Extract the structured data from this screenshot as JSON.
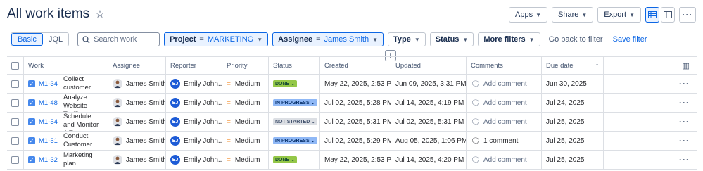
{
  "header": {
    "title": "All work items",
    "apps_label": "Apps",
    "share_label": "Share",
    "export_label": "Export"
  },
  "filters": {
    "basic_label": "Basic",
    "jql_label": "JQL",
    "search_placeholder": "Search work",
    "project": {
      "field": "Project",
      "op": "=",
      "value": "MARKETING"
    },
    "assignee": {
      "field": "Assignee",
      "op": "=",
      "value": "James Smith"
    },
    "type_label": "Type",
    "status_label": "Status",
    "more_filters_label": "More filters",
    "go_back_label": "Go back to filter",
    "save_filter_label": "Save filter"
  },
  "table": {
    "columns": [
      "Work",
      "Assignee",
      "Reporter",
      "Priority",
      "Status",
      "Created",
      "Updated",
      "Comments",
      "Due date"
    ],
    "rows": [
      {
        "key": "M1-34",
        "key_done": true,
        "title": "Collect customer...",
        "assignee": "James Smith",
        "reporter_initials": "EJ",
        "reporter": "Emily John...",
        "priority": "Medium",
        "status": "DONE",
        "status_class": "st-done",
        "status_chev": "⌄",
        "created": "May 22, 2025, 2:53 PM",
        "updated": "Jun 09, 2025, 3:31 PM",
        "comments": "Add comment",
        "comments_has": false,
        "due": "Jun 30, 2025"
      },
      {
        "key": "M1-48",
        "key_done": false,
        "title": "Analyze Website Traffi...",
        "assignee": "James Smith",
        "reporter_initials": "EJ",
        "reporter": "Emily John...",
        "priority": "Medium",
        "status": "IN PROGRESS",
        "status_class": "st-prog",
        "status_chev": "⌄",
        "created": "Jul 02, 2025, 5:28 PM",
        "updated": "Jul 14, 2025, 4:19 PM",
        "comments": "Add comment",
        "comments_has": false,
        "due": "Jul 24, 2025"
      },
      {
        "key": "M1-54",
        "key_done": false,
        "title": "Schedule and Monitor A/B...",
        "assignee": "James Smith",
        "reporter_initials": "EJ",
        "reporter": "Emily John...",
        "priority": "Medium",
        "status": "NOT STARTED",
        "status_class": "st-ns",
        "status_chev": "⌄",
        "created": "Jul 02, 2025, 5:31 PM",
        "updated": "Jul 02, 2025, 5:31 PM",
        "comments": "Add comment",
        "comments_has": false,
        "due": "Jul 25, 2025"
      },
      {
        "key": "M1-51",
        "key_done": false,
        "title": "Conduct Customer...",
        "assignee": "James Smith",
        "reporter_initials": "EJ",
        "reporter": "Emily John...",
        "priority": "Medium",
        "status": "IN PROGRESS",
        "status_class": "st-prog",
        "status_chev": "⌄",
        "created": "Jul 02, 2025, 5:29 PM",
        "updated": "Aug 05, 2025, 1:06 PM",
        "comments": "1 comment",
        "comments_has": true,
        "due": "Jul 25, 2025"
      },
      {
        "key": "M1-32",
        "key_done": true,
        "title": "Marketing plan",
        "assignee": "James Smith",
        "reporter_initials": "EJ",
        "reporter": "Emily John...",
        "priority": "Medium",
        "status": "DONE",
        "status_class": "st-done",
        "status_chev": "⌄",
        "created": "May 22, 2025, 2:53 PM",
        "updated": "Jul 14, 2025, 4:20 PM",
        "comments": "Add comment",
        "comments_has": false,
        "due": "Jul 25, 2025"
      }
    ]
  },
  "colors": {
    "accent": "#0c66e4",
    "done": "#94c748",
    "in_progress": "#8fb8f6",
    "not_started": "#dcdfe4",
    "priority_medium": "#f38c2b"
  }
}
